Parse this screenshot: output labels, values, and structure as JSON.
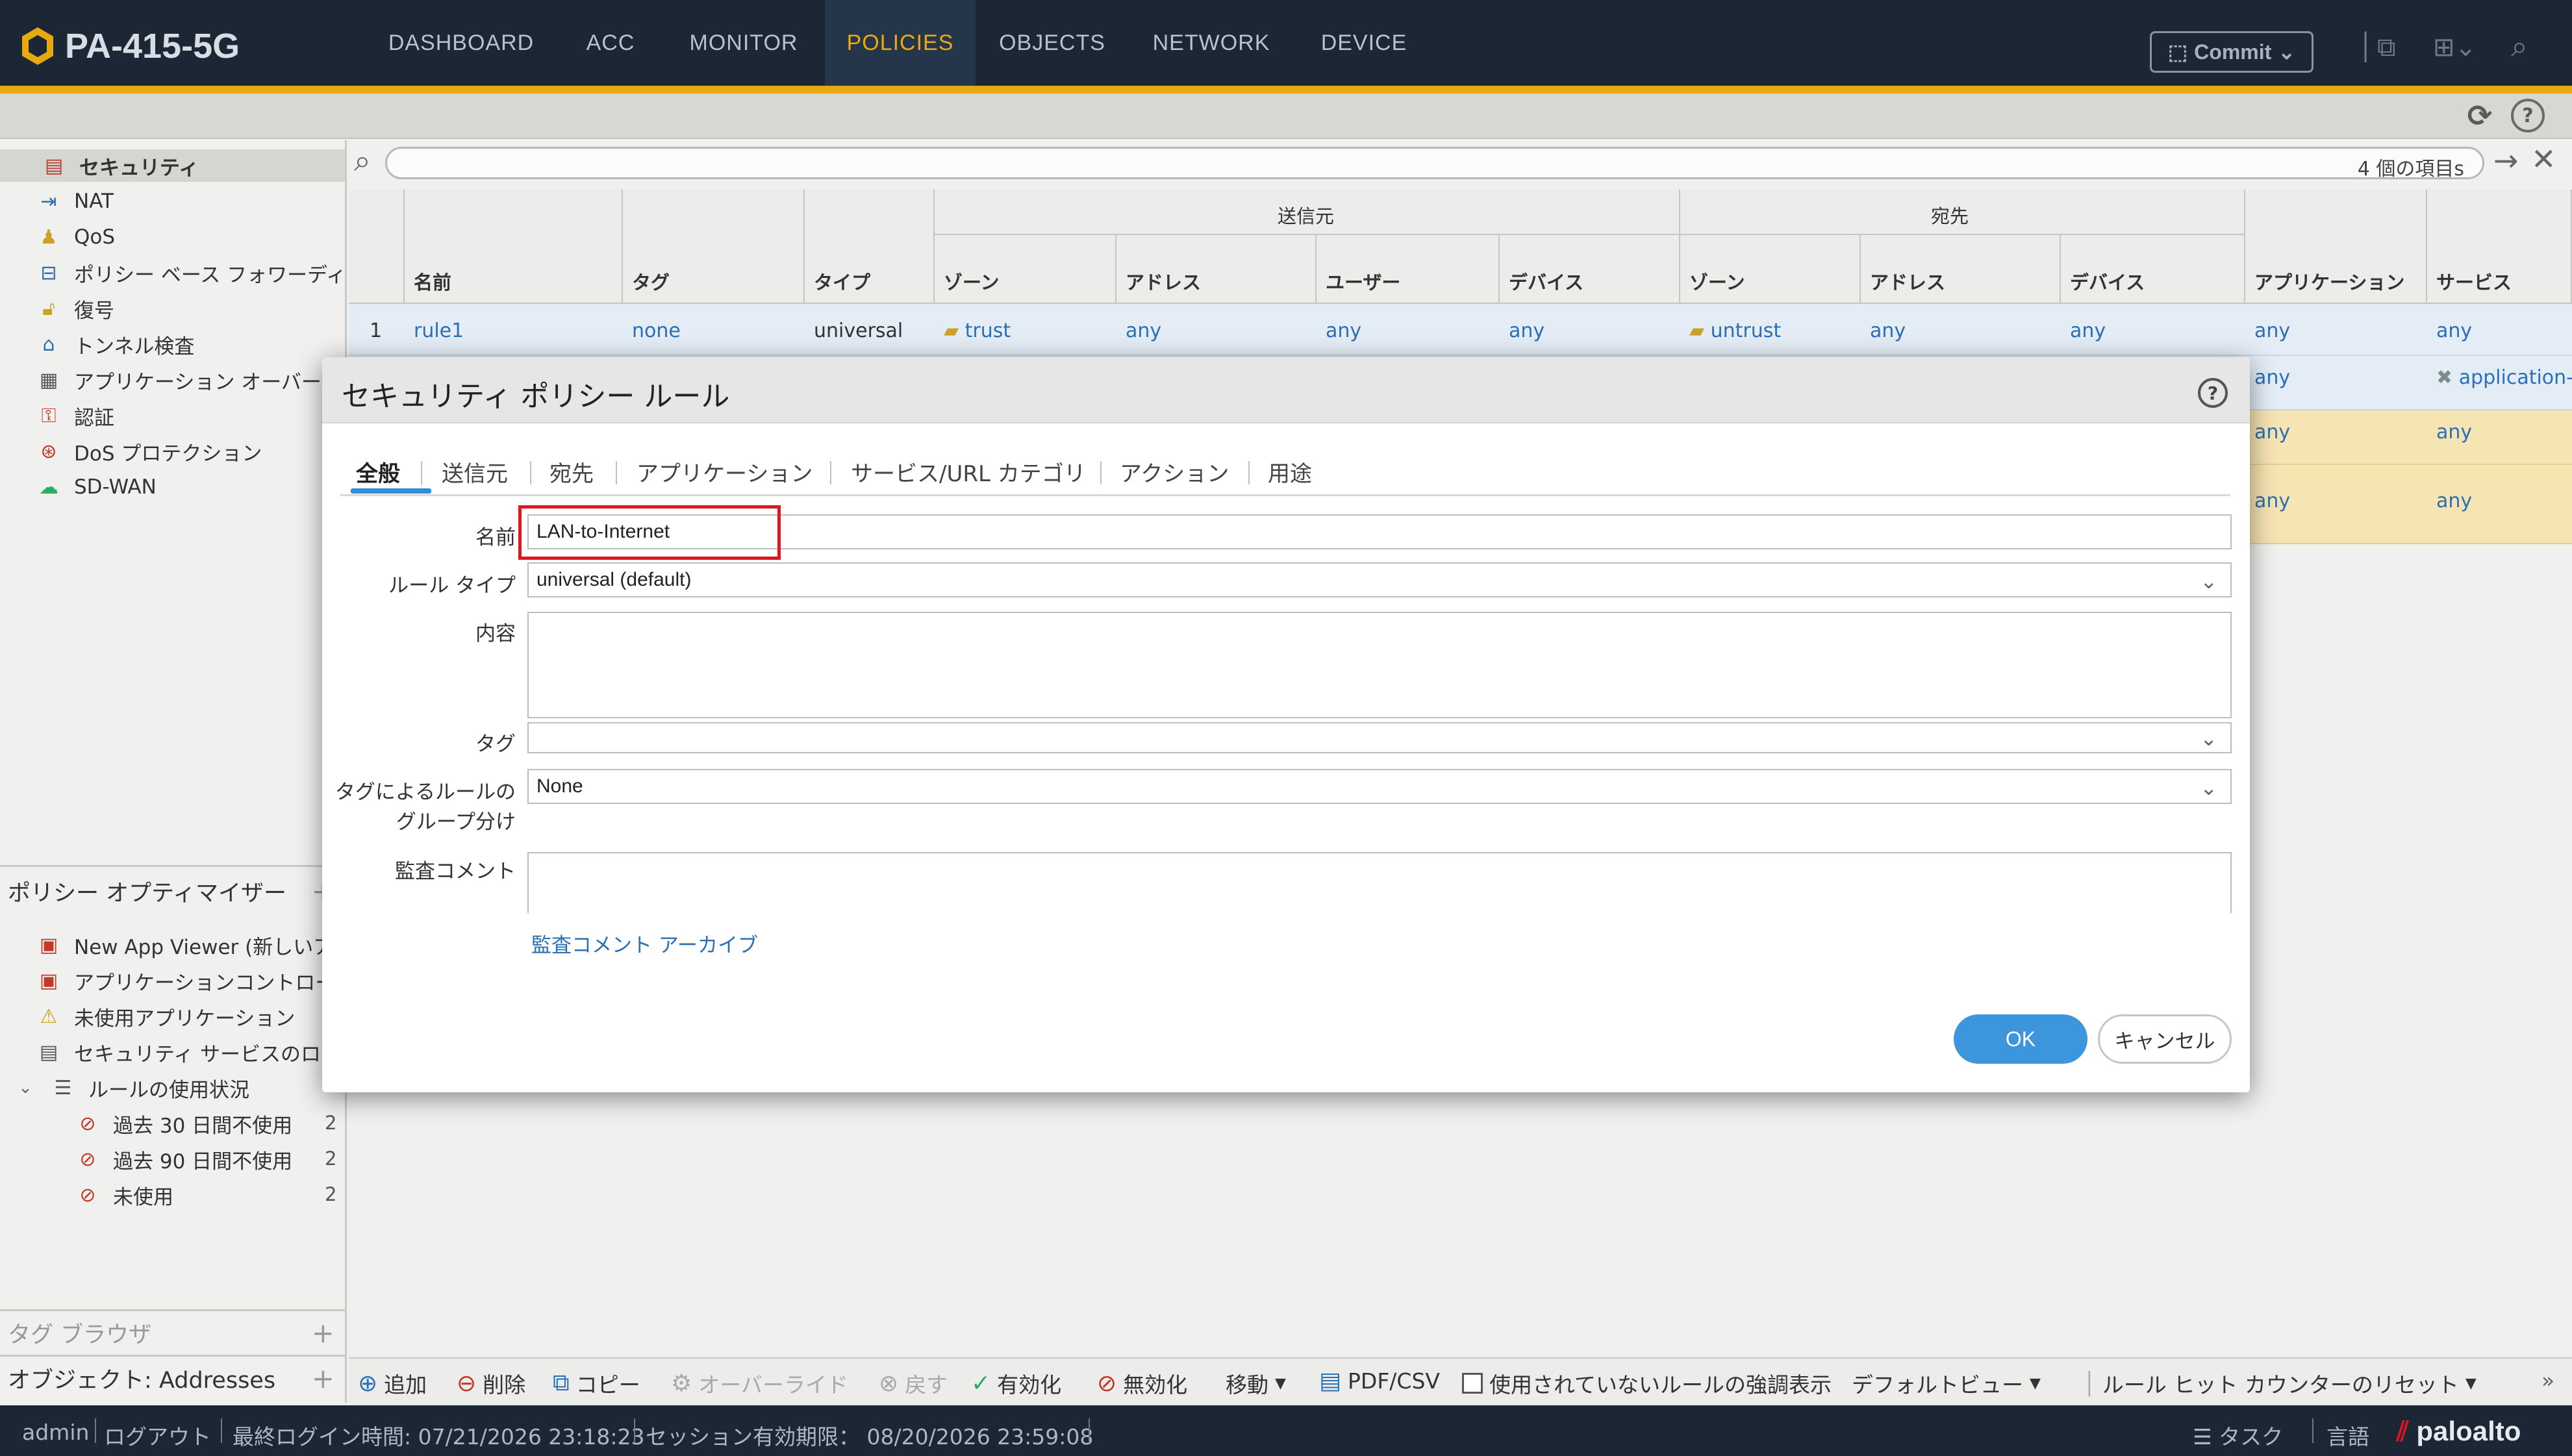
{
  "app": {
    "title": "PA-415-5G",
    "nav": [
      "DASHBOARD",
      "ACC",
      "MONITOR",
      "POLICIES",
      "OBJECTS",
      "NETWORK",
      "DEVICE"
    ],
    "active_nav": "POLICIES",
    "commit_label": "Commit"
  },
  "sidebar": {
    "items": [
      {
        "label": "セキュリティ",
        "icon": "security-rule-icon"
      },
      {
        "label": "NAT",
        "icon": "nat-icon"
      },
      {
        "label": "QoS",
        "icon": "qos-icon"
      },
      {
        "label": "ポリシー ベース フォワーディング",
        "icon": "pbf-icon"
      },
      {
        "label": "復号",
        "icon": "decryption-icon"
      },
      {
        "label": "トンネル検査",
        "icon": "tunnel-icon"
      },
      {
        "label": "アプリケーション オーバーライド",
        "icon": "app-override-icon"
      },
      {
        "label": "認証",
        "icon": "authentication-icon"
      },
      {
        "label": "DoS プロテクション",
        "icon": "dos-icon"
      },
      {
        "label": "SD-WAN",
        "icon": "sdwan-icon"
      }
    ],
    "optimizer_title": "ポリシー オプティマイザー",
    "optimizer_items": [
      {
        "label": "New App Viewer (新しいアプリ)",
        "icon": "new-app-viewer-icon"
      },
      {
        "label": "アプリケーションコントロール",
        "icon": "app-control-icon"
      },
      {
        "label": "未使用アプリケーション",
        "icon": "unused-app-icon"
      },
      {
        "label": "セキュリティ サービスのロ",
        "icon": "security-service-icon"
      }
    ],
    "usage_title": "ルールの使用状況",
    "usage_items": [
      {
        "label": "過去 30 日間不使用",
        "count": "2"
      },
      {
        "label": "過去 90 日間不使用",
        "count": "2"
      },
      {
        "label": "未使用",
        "count": "2"
      }
    ],
    "tag_browser": "タグ ブラウザ",
    "objects": "オブジェクト: Addresses"
  },
  "search": {
    "count_text": "4 個の項目s"
  },
  "table": {
    "group_source": "送信元",
    "group_dest": "宛先",
    "headers": [
      "名前",
      "タグ",
      "タイプ",
      "ゾーン",
      "アドレス",
      "ユーザー",
      "デバイス",
      "ゾーン",
      "アドレス",
      "デバイス",
      "アプリケーション",
      "サービス"
    ],
    "row1": {
      "num": "1",
      "name": "rule1",
      "tag": "none",
      "type": "universal",
      "src_zone": "trust",
      "src_addr": "any",
      "src_user": "any",
      "src_device": "any",
      "dst_zone": "untrust",
      "dst_addr": "any",
      "dst_device": "any",
      "application": "any",
      "service": "any"
    },
    "row2": {
      "application": "any",
      "service": "application-"
    },
    "row3": {
      "application": "any",
      "service": "any"
    },
    "row4": {
      "application": "any",
      "service": "any"
    }
  },
  "dialog": {
    "title": "セキュリティ ポリシー ルール",
    "tabs": [
      "全般",
      "送信元",
      "宛先",
      "アプリケーション",
      "サービス/URL カテゴリ",
      "アクション",
      "用途"
    ],
    "active_tab": "全般",
    "fields": {
      "name_label": "名前",
      "name_value": "LAN-to-Internet",
      "rule_type_label": "ルール タイプ",
      "rule_type_value": "universal (default)",
      "description_label": "内容",
      "tag_label": "タグ",
      "group_label_1": "タグによるルールの",
      "group_label_2": "グループ分け",
      "group_value": "None",
      "audit_label": "監査コメント"
    },
    "audit_archive_link": "監査コメント アーカイブ",
    "ok_label": "OK",
    "cancel_label": "キャンセル"
  },
  "bottom_toolbar": {
    "add": "追加",
    "delete": "削除",
    "copy": "コピー",
    "override": "オーバーライド",
    "revert": "戻す",
    "enable": "有効化",
    "disable": "無効化",
    "move": "移動",
    "pdf_csv": "PDF/CSV",
    "highlight_unused": "使用されていないルールの強調表示",
    "default_view": "デフォルトビュー",
    "reset_hit_counter": "ルール ヒット カウンターのリセット"
  },
  "status_bar": {
    "user": "admin",
    "logout": "ログアウト",
    "last_login": "最終ログイン時間: 07/21/2026 23:18:23",
    "session_expiry": "セッション有効期限： 08/20/2026 23:59:08",
    "tasks": "タスク",
    "language": "言語",
    "brand": "paloalto"
  },
  "colors": {
    "topbar": "#1b2735",
    "accent_gold": "#e8a80f",
    "link_blue": "#2b6fb5",
    "ok_blue": "#3d95dc",
    "highlight_red": "#e0161e"
  }
}
